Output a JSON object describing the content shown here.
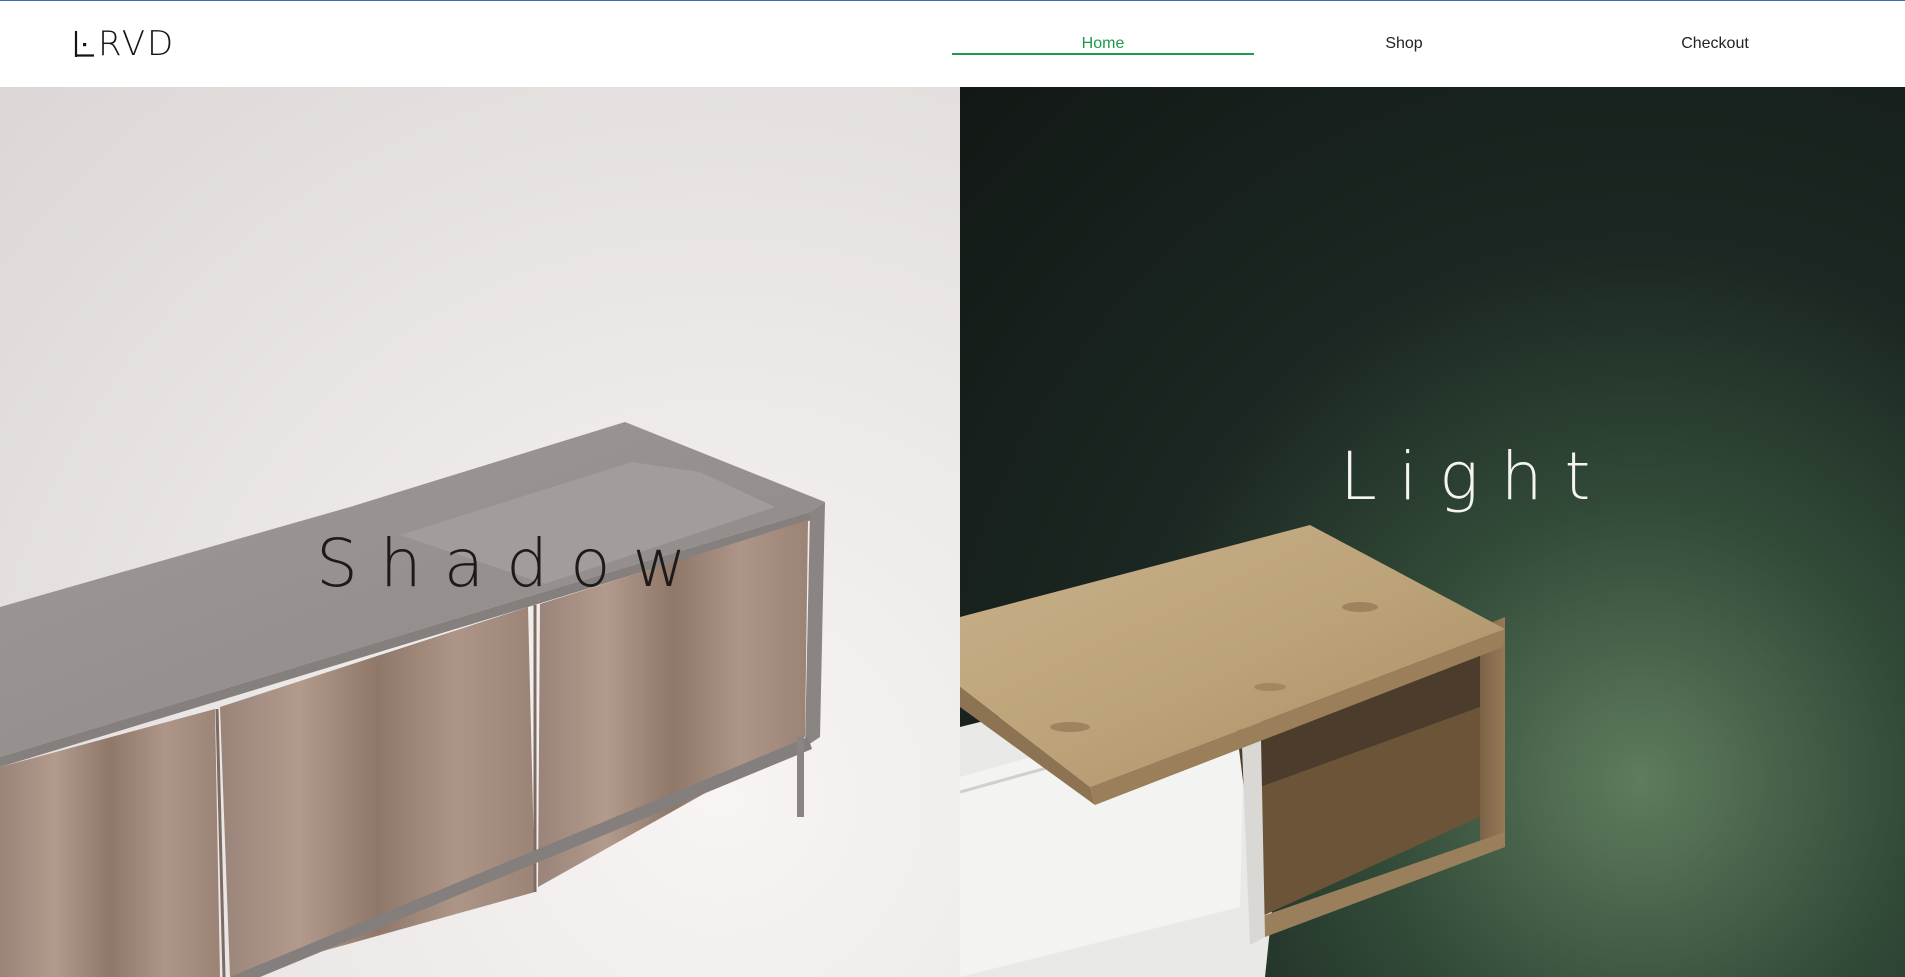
{
  "brand": {
    "logo_text": "RVD",
    "logo_alt": "HRVD"
  },
  "nav": {
    "items": [
      {
        "label": "Home",
        "active": true
      },
      {
        "label": "Shop",
        "active": false
      },
      {
        "label": "Checkout",
        "active": false
      }
    ]
  },
  "hero": {
    "left_word": "Shadow",
    "right_word": "Light"
  },
  "colors": {
    "accent": "#1d9a4b",
    "left_panel": "#e6e2e1",
    "right_panel": "#1b2722"
  }
}
